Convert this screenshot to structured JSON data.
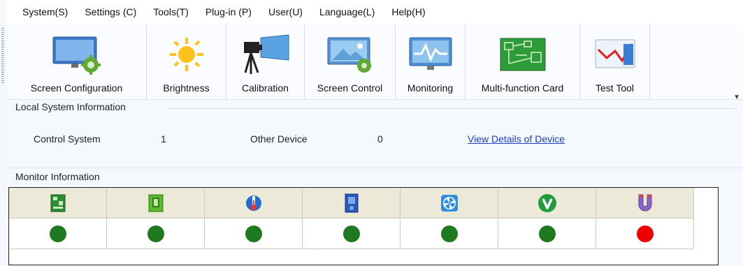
{
  "menu": [
    {
      "label": "System(S)"
    },
    {
      "label": "Settings (C)"
    },
    {
      "label": "Tools(T)"
    },
    {
      "label": "Plug-in (P)"
    },
    {
      "label": "User(U)"
    },
    {
      "label": "Language(L)"
    },
    {
      "label": "Help(H)"
    }
  ],
  "toolbar": [
    {
      "label": "Screen Configuration",
      "icon": "screen-configuration-icon"
    },
    {
      "label": "Brightness",
      "icon": "sun-icon"
    },
    {
      "label": "Calibration",
      "icon": "camera-tripod-icon"
    },
    {
      "label": "Screen Control",
      "icon": "screen-control-icon"
    },
    {
      "label": "Monitoring",
      "icon": "monitoring-icon"
    },
    {
      "label": "Multi-function Card",
      "icon": "circuit-board-icon"
    },
    {
      "label": "Test Tool",
      "icon": "chart-icon"
    }
  ],
  "local_info": {
    "title": "Local System Information",
    "control_system_label": "Control System",
    "control_system_value": "1",
    "other_device_label": "Other Device",
    "other_device_value": "0",
    "details_link": "View Details of Device"
  },
  "monitor_info": {
    "title": "Monitor Information",
    "columns": [
      {
        "icon": "receiving-card-icon",
        "status": "green"
      },
      {
        "icon": "module-icon",
        "status": "green"
      },
      {
        "icon": "temperature-icon",
        "status": "green"
      },
      {
        "icon": "cabinet-door-icon",
        "status": "green"
      },
      {
        "icon": "fan-icon",
        "status": "green"
      },
      {
        "icon": "voltage-icon",
        "status": "green"
      },
      {
        "icon": "magnet-icon",
        "status": "red"
      }
    ]
  },
  "colors": {
    "status_green": "#1f7a1f",
    "status_red": "#ee0000",
    "link": "#1b3fc8",
    "grid_header": "#ece9d8"
  }
}
